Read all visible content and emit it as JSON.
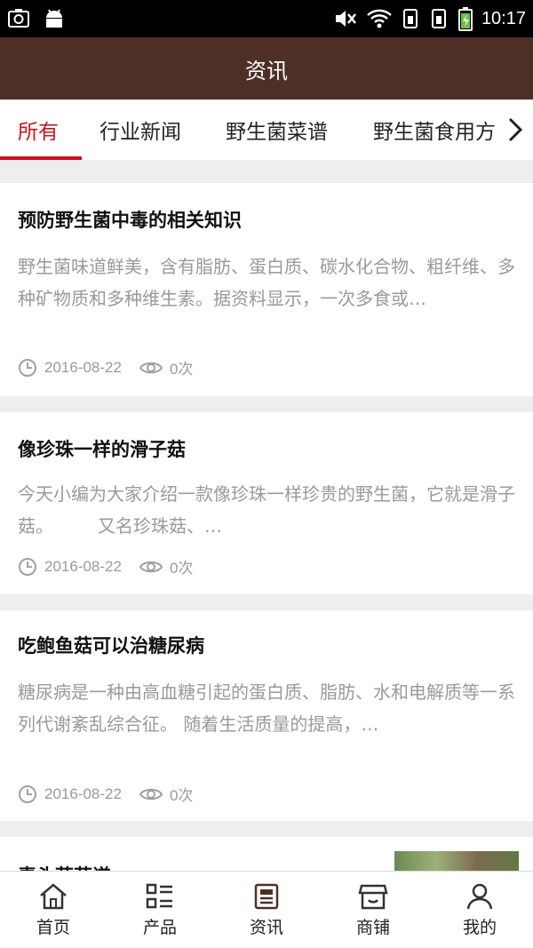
{
  "status_bar": {
    "time": "10:17"
  },
  "header": {
    "title": "资讯"
  },
  "tabs": [
    {
      "label": "所有",
      "active": true
    },
    {
      "label": "行业新闻",
      "active": false
    },
    {
      "label": "野生菌菜谱",
      "active": false
    },
    {
      "label": "野生菌食用方",
      "active": false
    }
  ],
  "articles": [
    {
      "title": "预防野生菌中毒的相关知识",
      "summary": "野生菌味道鲜美，含有脂肪、蛋白质、碳水化合物、粗纤维、多种矿物质和多种维生素。据资料显示，一次多食或…",
      "date": "2016-08-22",
      "views": "0次"
    },
    {
      "title": "像珍珠一样的滑子菇",
      "summary": "今天小编为大家介绍一款像珍珠一样珍贵的野生菌，它就是滑子菇。　　　又名珍珠菇、…",
      "date": "2016-08-22",
      "views": "0次"
    },
    {
      "title": "吃鲍鱼菇可以治糖尿病",
      "summary": "糖尿病是一种由高血糖引起的蛋白质、脂肪、水和电解质等一系列代谢紊乱综合征。 随着生活质量的提高，…",
      "date": "2016-08-22",
      "views": "0次"
    },
    {
      "title": "毒头菇菇谱",
      "summary": "",
      "date": "",
      "views": ""
    }
  ],
  "bottom_nav": [
    {
      "label": "首页",
      "icon": "home-icon"
    },
    {
      "label": "产品",
      "icon": "grid-list-icon"
    },
    {
      "label": "资讯",
      "icon": "news-icon"
    },
    {
      "label": "商铺",
      "icon": "store-icon"
    },
    {
      "label": "我的",
      "icon": "user-icon"
    }
  ],
  "colors": {
    "header_bg": "#4e2f27",
    "accent": "#c8141e",
    "muted_text": "#9a9a9a"
  }
}
